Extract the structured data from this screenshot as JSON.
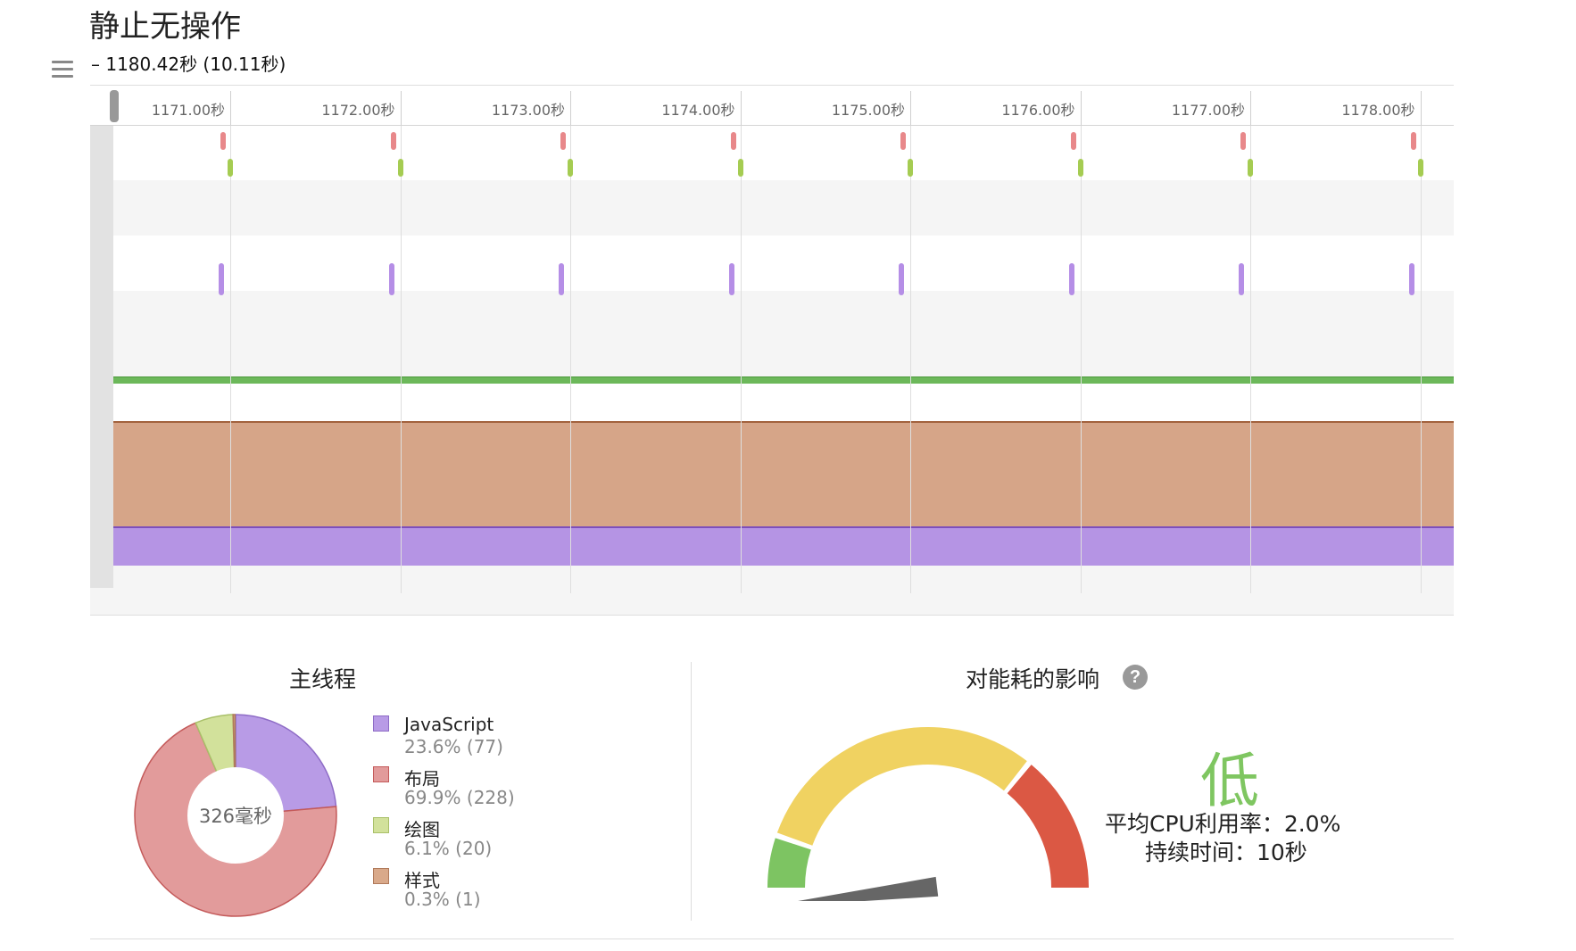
{
  "header": {
    "title": "静止无操作",
    "range": "– 1180.42秒 (10.11秒)"
  },
  "timeline": {
    "ticks": [
      "1171.00秒",
      "1172.00秒",
      "1173.00秒",
      "1174.00秒",
      "1175.00秒",
      "1176.00秒",
      "1177.00秒",
      "1178.00秒"
    ],
    "colors": {
      "red": "#e8888a",
      "green": "#a5cc52",
      "purple": "#b58ee6",
      "cpu_green": "#6cb85a",
      "style_band": "#d6a588",
      "script_band": "#b594e4"
    }
  },
  "main_thread": {
    "title": "主线程",
    "total": "326毫秒",
    "items": [
      {
        "name": "JavaScript",
        "value": "23.6% (77)",
        "percent": 23.6,
        "color": "#b89be6",
        "border": "#8e6cc6"
      },
      {
        "name": "布局",
        "value": "69.9% (228)",
        "percent": 69.9,
        "color": "#e29b9b",
        "border": "#c45a5a"
      },
      {
        "name": "绘图",
        "value": "6.1% (20)",
        "percent": 6.1,
        "color": "#d2e19b",
        "border": "#a9c069"
      },
      {
        "name": "样式",
        "value": "0.3% (1)",
        "percent": 0.3,
        "color": "#d9a98a",
        "border": "#b07a5b"
      }
    ]
  },
  "energy": {
    "title": "对能耗的影响",
    "help_icon": "question-icon",
    "level": "低",
    "cpu_usage": "平均CPU利用率：2.0%",
    "duration": "持续时间：10秒",
    "gauge_value_fraction": 0.04,
    "colors": {
      "low": "#7dc462",
      "mid": "#f0d261",
      "high": "#db5844",
      "needle": "#666666"
    }
  }
}
